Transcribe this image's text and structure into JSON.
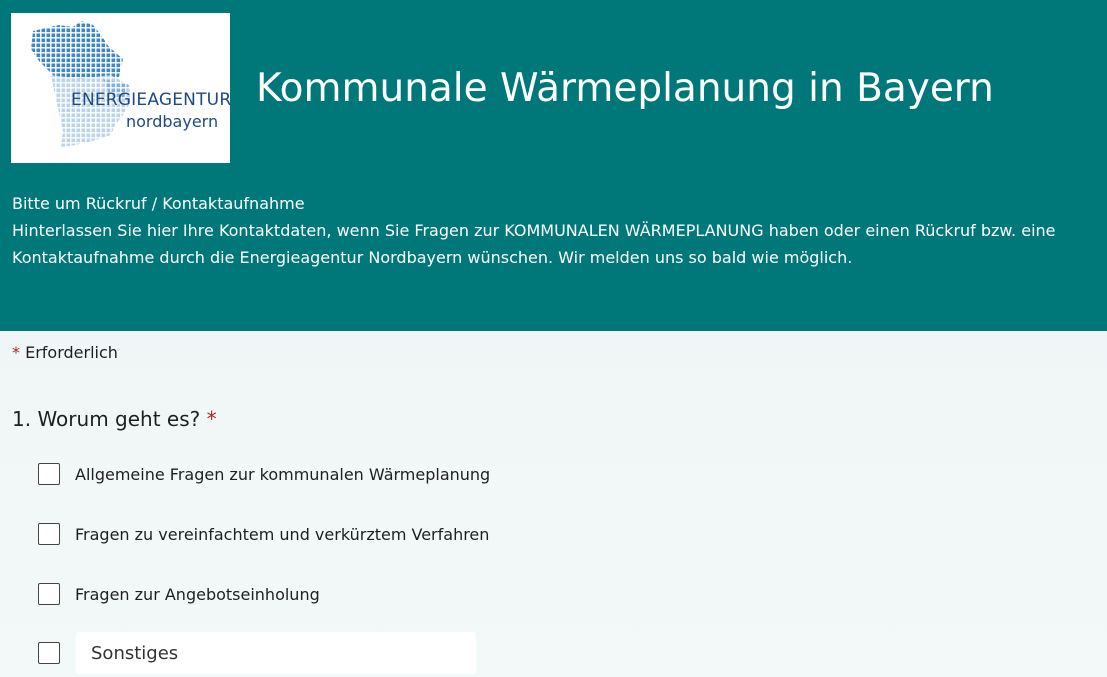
{
  "header": {
    "logo": {
      "line1": "ENERGIEAGENTUR",
      "line2": "nordbayern"
    },
    "title": "Kommunale Wärmeplanung in Bayern",
    "subtitle": "Bitte um Rückruf / Kontaktaufnahme",
    "description_line1": "Hinterlassen Sie hier Ihre Kontaktdaten, wenn Sie Fragen zur KOMMUNALEN WÄRMEPLANUNG haben oder einen Rückruf bzw. eine",
    "description_line2": "Kontaktaufnahme durch die Energieagentur Nordbayern wünschen. Wir melden uns so bald wie möglich.",
    "background_color": "#00787a"
  },
  "form": {
    "required_marker": "*",
    "required_label": "Erforderlich",
    "question1": {
      "number": "1.",
      "text": "Worum geht es?",
      "required_marker": "*",
      "options": [
        {
          "label": "Allgemeine Fragen zur kommunalen Wärmeplanung",
          "checked": false
        },
        {
          "label": "Fragen zu vereinfachtem und verkürztem Verfahren",
          "checked": false
        },
        {
          "label": "Fragen zur Angebotseinholung",
          "checked": false
        }
      ],
      "other": {
        "checked": false,
        "placeholder": "Sonstiges"
      }
    }
  },
  "colors": {
    "accent": "#00787a",
    "required": "#a4262c",
    "logo_blue": "#1c4a83"
  },
  "icons": {
    "logo": "bavaria-map-logo",
    "checkbox": "checkbox-empty"
  }
}
